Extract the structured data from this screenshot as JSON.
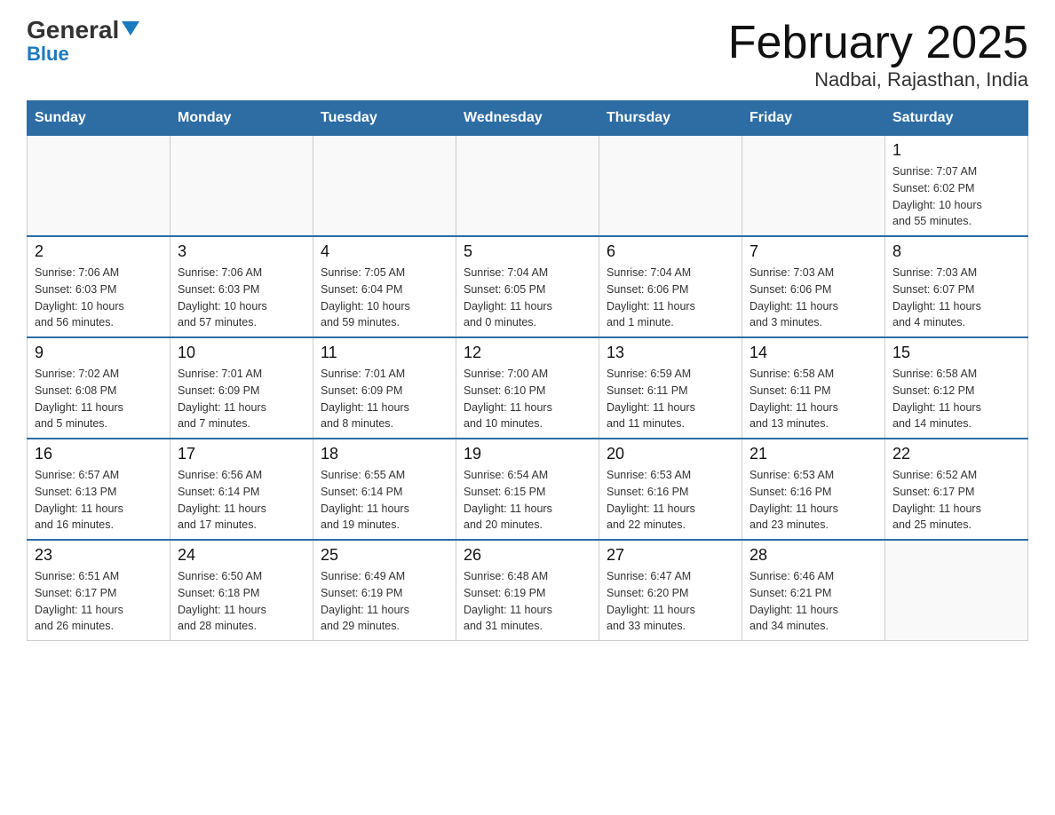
{
  "header": {
    "logo_general": "General",
    "logo_blue": "Blue",
    "month_title": "February 2025",
    "location": "Nadbai, Rajasthan, India"
  },
  "weekdays": [
    "Sunday",
    "Monday",
    "Tuesday",
    "Wednesday",
    "Thursday",
    "Friday",
    "Saturday"
  ],
  "weeks": [
    [
      {
        "day": "",
        "info": ""
      },
      {
        "day": "",
        "info": ""
      },
      {
        "day": "",
        "info": ""
      },
      {
        "day": "",
        "info": ""
      },
      {
        "day": "",
        "info": ""
      },
      {
        "day": "",
        "info": ""
      },
      {
        "day": "1",
        "info": "Sunrise: 7:07 AM\nSunset: 6:02 PM\nDaylight: 10 hours\nand 55 minutes."
      }
    ],
    [
      {
        "day": "2",
        "info": "Sunrise: 7:06 AM\nSunset: 6:03 PM\nDaylight: 10 hours\nand 56 minutes."
      },
      {
        "day": "3",
        "info": "Sunrise: 7:06 AM\nSunset: 6:03 PM\nDaylight: 10 hours\nand 57 minutes."
      },
      {
        "day": "4",
        "info": "Sunrise: 7:05 AM\nSunset: 6:04 PM\nDaylight: 10 hours\nand 59 minutes."
      },
      {
        "day": "5",
        "info": "Sunrise: 7:04 AM\nSunset: 6:05 PM\nDaylight: 11 hours\nand 0 minutes."
      },
      {
        "day": "6",
        "info": "Sunrise: 7:04 AM\nSunset: 6:06 PM\nDaylight: 11 hours\nand 1 minute."
      },
      {
        "day": "7",
        "info": "Sunrise: 7:03 AM\nSunset: 6:06 PM\nDaylight: 11 hours\nand 3 minutes."
      },
      {
        "day": "8",
        "info": "Sunrise: 7:03 AM\nSunset: 6:07 PM\nDaylight: 11 hours\nand 4 minutes."
      }
    ],
    [
      {
        "day": "9",
        "info": "Sunrise: 7:02 AM\nSunset: 6:08 PM\nDaylight: 11 hours\nand 5 minutes."
      },
      {
        "day": "10",
        "info": "Sunrise: 7:01 AM\nSunset: 6:09 PM\nDaylight: 11 hours\nand 7 minutes."
      },
      {
        "day": "11",
        "info": "Sunrise: 7:01 AM\nSunset: 6:09 PM\nDaylight: 11 hours\nand 8 minutes."
      },
      {
        "day": "12",
        "info": "Sunrise: 7:00 AM\nSunset: 6:10 PM\nDaylight: 11 hours\nand 10 minutes."
      },
      {
        "day": "13",
        "info": "Sunrise: 6:59 AM\nSunset: 6:11 PM\nDaylight: 11 hours\nand 11 minutes."
      },
      {
        "day": "14",
        "info": "Sunrise: 6:58 AM\nSunset: 6:11 PM\nDaylight: 11 hours\nand 13 minutes."
      },
      {
        "day": "15",
        "info": "Sunrise: 6:58 AM\nSunset: 6:12 PM\nDaylight: 11 hours\nand 14 minutes."
      }
    ],
    [
      {
        "day": "16",
        "info": "Sunrise: 6:57 AM\nSunset: 6:13 PM\nDaylight: 11 hours\nand 16 minutes."
      },
      {
        "day": "17",
        "info": "Sunrise: 6:56 AM\nSunset: 6:14 PM\nDaylight: 11 hours\nand 17 minutes."
      },
      {
        "day": "18",
        "info": "Sunrise: 6:55 AM\nSunset: 6:14 PM\nDaylight: 11 hours\nand 19 minutes."
      },
      {
        "day": "19",
        "info": "Sunrise: 6:54 AM\nSunset: 6:15 PM\nDaylight: 11 hours\nand 20 minutes."
      },
      {
        "day": "20",
        "info": "Sunrise: 6:53 AM\nSunset: 6:16 PM\nDaylight: 11 hours\nand 22 minutes."
      },
      {
        "day": "21",
        "info": "Sunrise: 6:53 AM\nSunset: 6:16 PM\nDaylight: 11 hours\nand 23 minutes."
      },
      {
        "day": "22",
        "info": "Sunrise: 6:52 AM\nSunset: 6:17 PM\nDaylight: 11 hours\nand 25 minutes."
      }
    ],
    [
      {
        "day": "23",
        "info": "Sunrise: 6:51 AM\nSunset: 6:17 PM\nDaylight: 11 hours\nand 26 minutes."
      },
      {
        "day": "24",
        "info": "Sunrise: 6:50 AM\nSunset: 6:18 PM\nDaylight: 11 hours\nand 28 minutes."
      },
      {
        "day": "25",
        "info": "Sunrise: 6:49 AM\nSunset: 6:19 PM\nDaylight: 11 hours\nand 29 minutes."
      },
      {
        "day": "26",
        "info": "Sunrise: 6:48 AM\nSunset: 6:19 PM\nDaylight: 11 hours\nand 31 minutes."
      },
      {
        "day": "27",
        "info": "Sunrise: 6:47 AM\nSunset: 6:20 PM\nDaylight: 11 hours\nand 33 minutes."
      },
      {
        "day": "28",
        "info": "Sunrise: 6:46 AM\nSunset: 6:21 PM\nDaylight: 11 hours\nand 34 minutes."
      },
      {
        "day": "",
        "info": ""
      }
    ]
  ]
}
